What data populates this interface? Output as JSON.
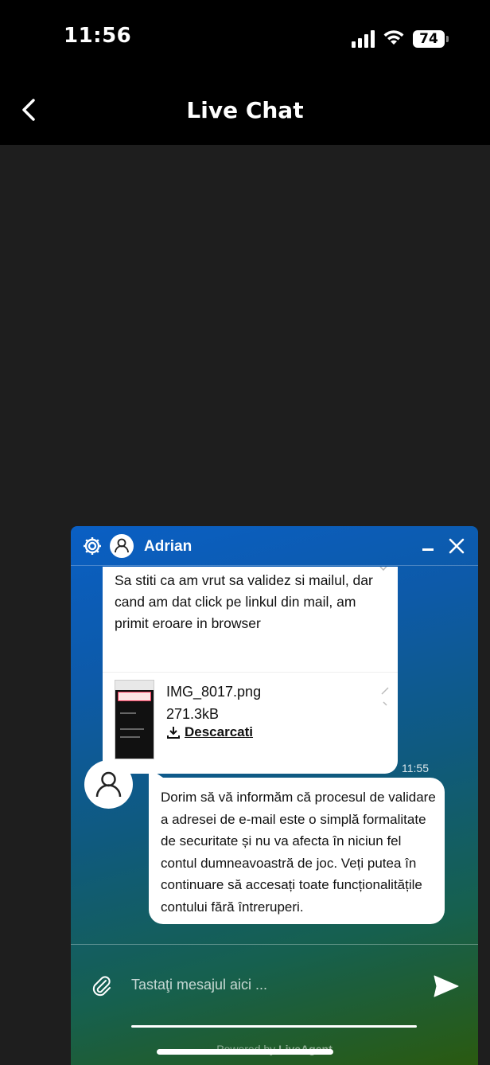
{
  "status_bar": {
    "time": "11:56",
    "battery": "74"
  },
  "nav": {
    "title": "Live Chat"
  },
  "widget": {
    "agent_name": "Adrian",
    "user_message": "Sa stiti ca am vrut sa validez si mailul, dar cand am dat click pe linkul din mail, am primit eroare in browser",
    "attachment": {
      "file_name": "IMG_8017.png",
      "file_size": "271.3kB",
      "download_label": "Descarcati"
    },
    "agent_message": {
      "time": "11:55",
      "text": "Dorim să vă informăm că procesul de validare a adresei de e-mail este o simplă formalitate de securitate și nu va afecta în niciun fel contul dumneavoastră de joc. Veți putea în continuare să accesați toate funcționalitățile contului fără întreruperi."
    },
    "composer": {
      "placeholder": "Tastaţi mesajul aici ..."
    },
    "powered_by_prefix": "Powered by",
    "powered_by_brand": "LiveAgent"
  },
  "colors": {
    "widget_top": "#0a5fc4",
    "widget_bottom": "#2a5a10",
    "page_bg": "#1e1e1e"
  }
}
